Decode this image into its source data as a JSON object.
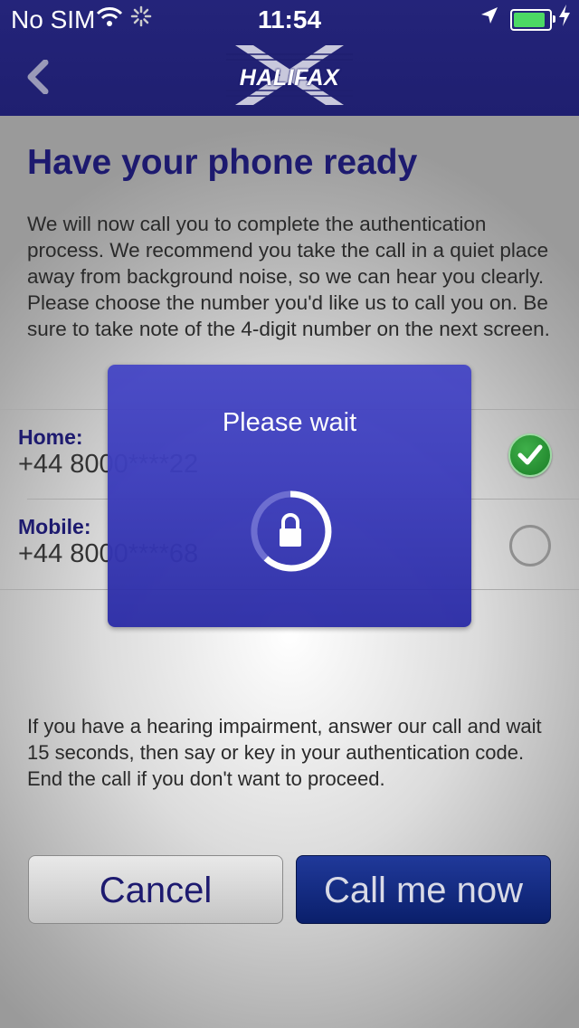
{
  "status_bar": {
    "carrier": "No SIM",
    "time": "11:54",
    "battery_level": 1.0
  },
  "nav": {
    "back_icon": "chevron-left-icon",
    "logo_text": "HALIFAX"
  },
  "page": {
    "title": "Have your phone ready",
    "intro": "We will now call you to complete the authentication process. We recommend you take the call in a quiet place away from background noise, so we can hear you clearly. Please choose the number you'd like us to call you on. Be sure to take note of the 4-digit number on the next screen."
  },
  "options": [
    {
      "label": "Home:",
      "number": "+44 8000****22",
      "selected": true
    },
    {
      "label": "Mobile:",
      "number": "+44 8000****68",
      "selected": false
    }
  ],
  "modal": {
    "title": "Please wait",
    "icon": "lock-icon"
  },
  "note": "If you have a hearing impairment, answer our call and wait 15 seconds, then say or key in your authentication code. End the call if you don't want to proceed.",
  "buttons": {
    "cancel": "Cancel",
    "call": "Call me now"
  },
  "colors": {
    "nav_bg": "#1f1f70",
    "title_text": "#1d1a6f",
    "modal_bg": "#3d3ebd",
    "check_green": "#2a9a36",
    "call_button_bg": "#0a1f6b"
  }
}
